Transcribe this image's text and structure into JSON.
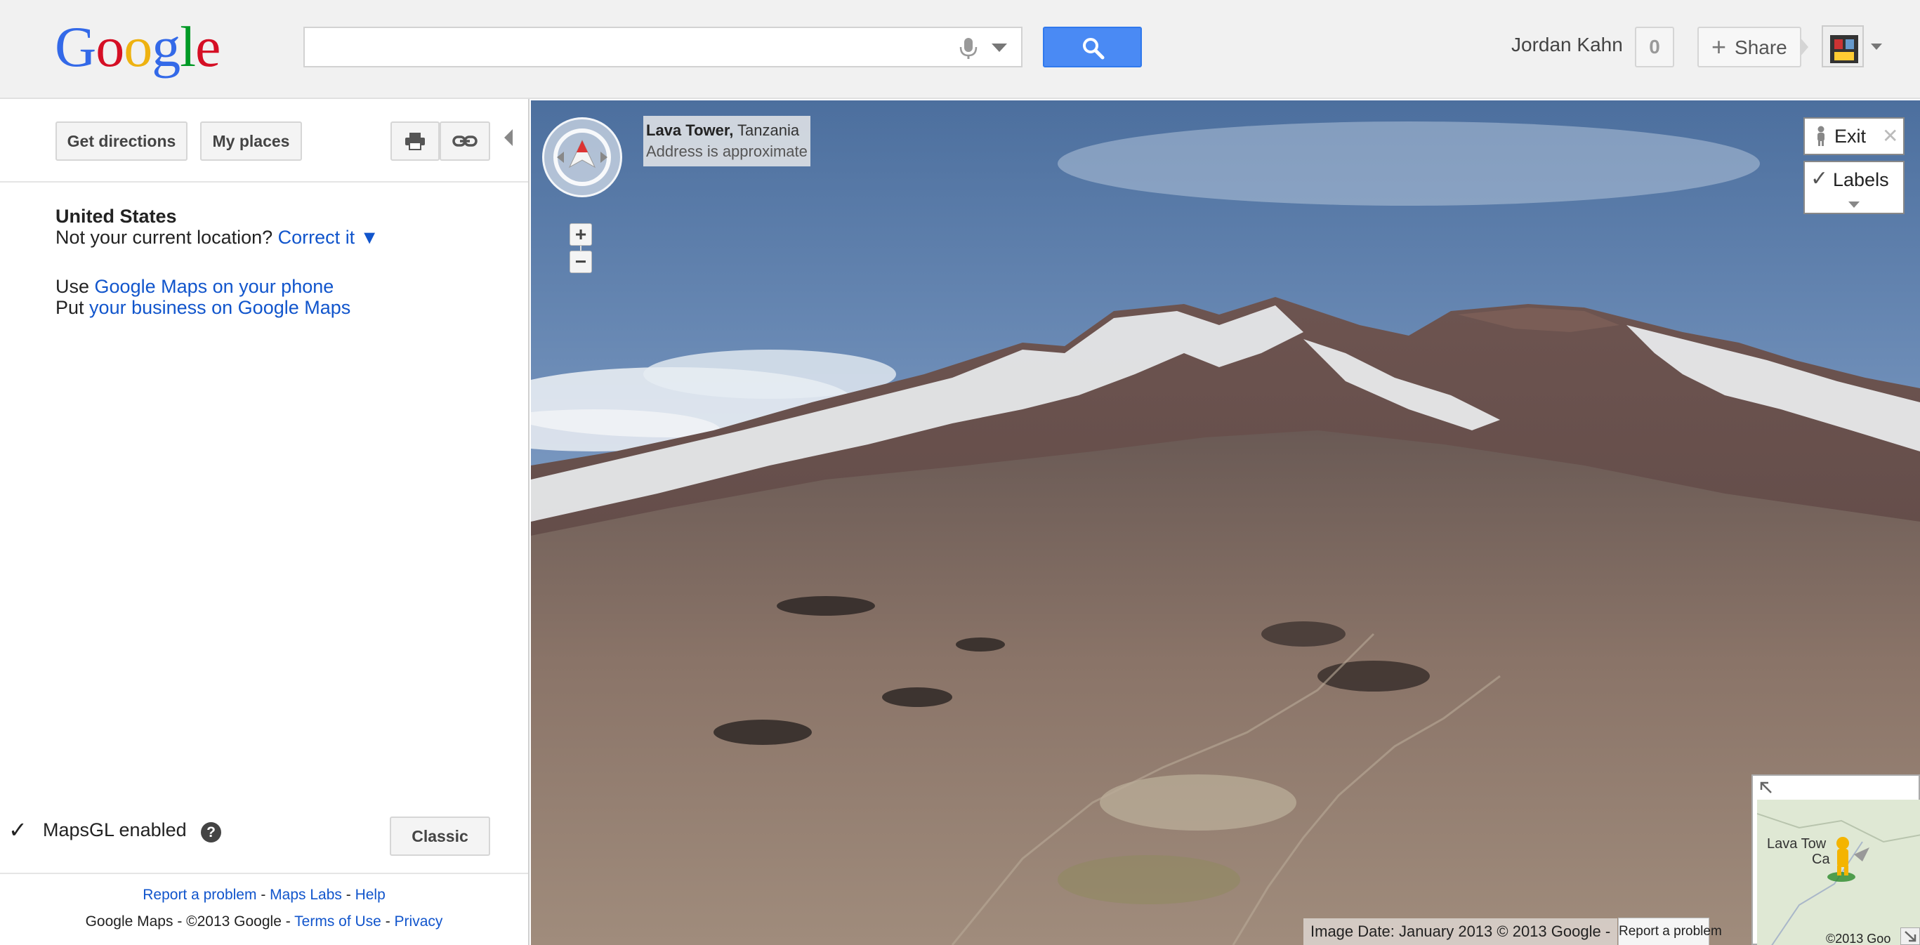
{
  "header": {
    "logo_letters": [
      {
        "char": "G",
        "color": "#3369e8"
      },
      {
        "char": "o",
        "color": "#d50f25"
      },
      {
        "char": "o",
        "color": "#eeb211"
      },
      {
        "char": "g",
        "color": "#3369e8"
      },
      {
        "char": "l",
        "color": "#009925"
      },
      {
        "char": "e",
        "color": "#d50f25"
      }
    ],
    "search_value": "",
    "user_name": "Jordan Kahn",
    "notification_count": "0",
    "share_label": "Share"
  },
  "sidebar": {
    "get_directions_label": "Get directions",
    "my_places_label": "My places",
    "location_country": "United States",
    "not_current_text": "Not your current location?",
    "correct_it_link": "Correct it ▼",
    "use_text": "Use",
    "phone_link": "Google Maps on your phone",
    "put_text": "Put",
    "business_link": "your business on Google Maps",
    "mapsgl_check": "✓",
    "mapsgl_label": "MapsGL enabled",
    "help_glyph": "?",
    "classic_label": "Classic",
    "footer": {
      "report_link": "Report a problem",
      "labs_link": "Maps Labs",
      "help_link": "Help",
      "sep": " - ",
      "copyright_text": "Google Maps - ©2013 Google - ",
      "terms_link": "Terms of Use",
      "privacy_link": "Privacy"
    }
  },
  "streetview": {
    "place_name": "Lava Tower,",
    "place_region": "Tanzania",
    "address_note": "Address is approximate",
    "zoom_in": "+",
    "zoom_out": "−",
    "exit_label": "Exit",
    "exit_close": "✕",
    "labels_check": "✓",
    "labels_label": "Labels",
    "image_date": "Image Date: January 2013 © 2013 Google -",
    "report_label": "Report a problem",
    "minimap_label_line1": "Lava Tow",
    "minimap_label_line2": "Ca",
    "minimap_copy": "©2013 Goo"
  },
  "colors": {
    "accent_blue": "#4a8af4",
    "link_blue": "#1155cc"
  }
}
